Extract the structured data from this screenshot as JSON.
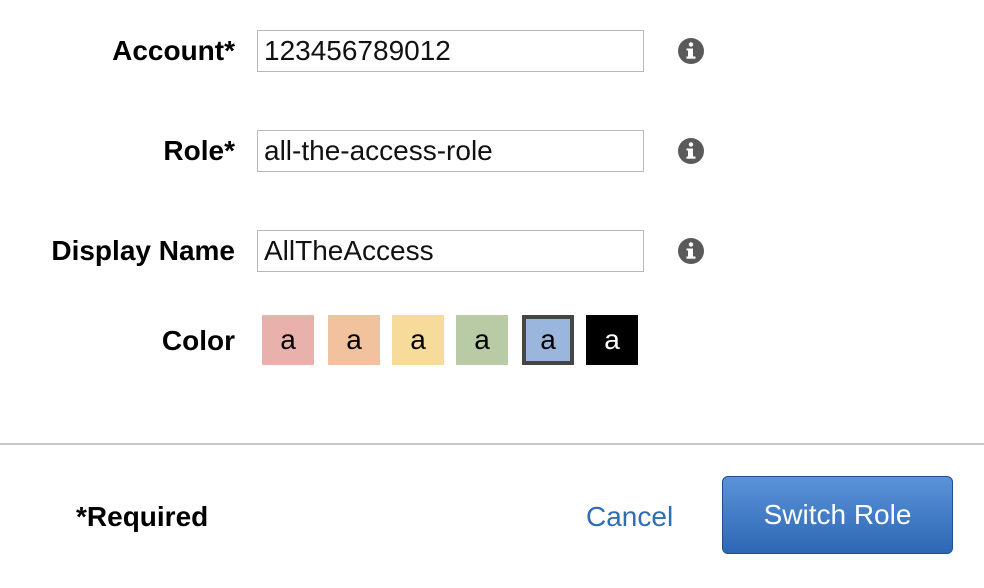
{
  "form": {
    "account": {
      "label": "Account*",
      "value": "123456789012"
    },
    "role": {
      "label": "Role*",
      "value": "all-the-access-role"
    },
    "display_name": {
      "label": "Display Name",
      "value": "AllTheAccess"
    },
    "color": {
      "label": "Color",
      "swatches": [
        {
          "text": "a",
          "color": "#e8b1ab",
          "text_color": "#000000",
          "selected": false
        },
        {
          "text": "a",
          "color": "#f2c29f",
          "text_color": "#000000",
          "selected": false
        },
        {
          "text": "a",
          "color": "#f6db9b",
          "text_color": "#000000",
          "selected": false
        },
        {
          "text": "a",
          "color": "#b8cba4",
          "text_color": "#000000",
          "selected": false
        },
        {
          "text": "a",
          "color": "#9ab6dc",
          "text_color": "#000000",
          "selected": true
        },
        {
          "text": "a",
          "color": "#000000",
          "text_color": "#ffffff",
          "selected": false
        }
      ]
    }
  },
  "footer": {
    "required_note": "*Required",
    "cancel_label": "Cancel",
    "submit_label": "Switch Role"
  },
  "colors": {
    "link": "#2f6db5",
    "button": "#3f78c4",
    "info_icon": "#5a5a5a"
  }
}
